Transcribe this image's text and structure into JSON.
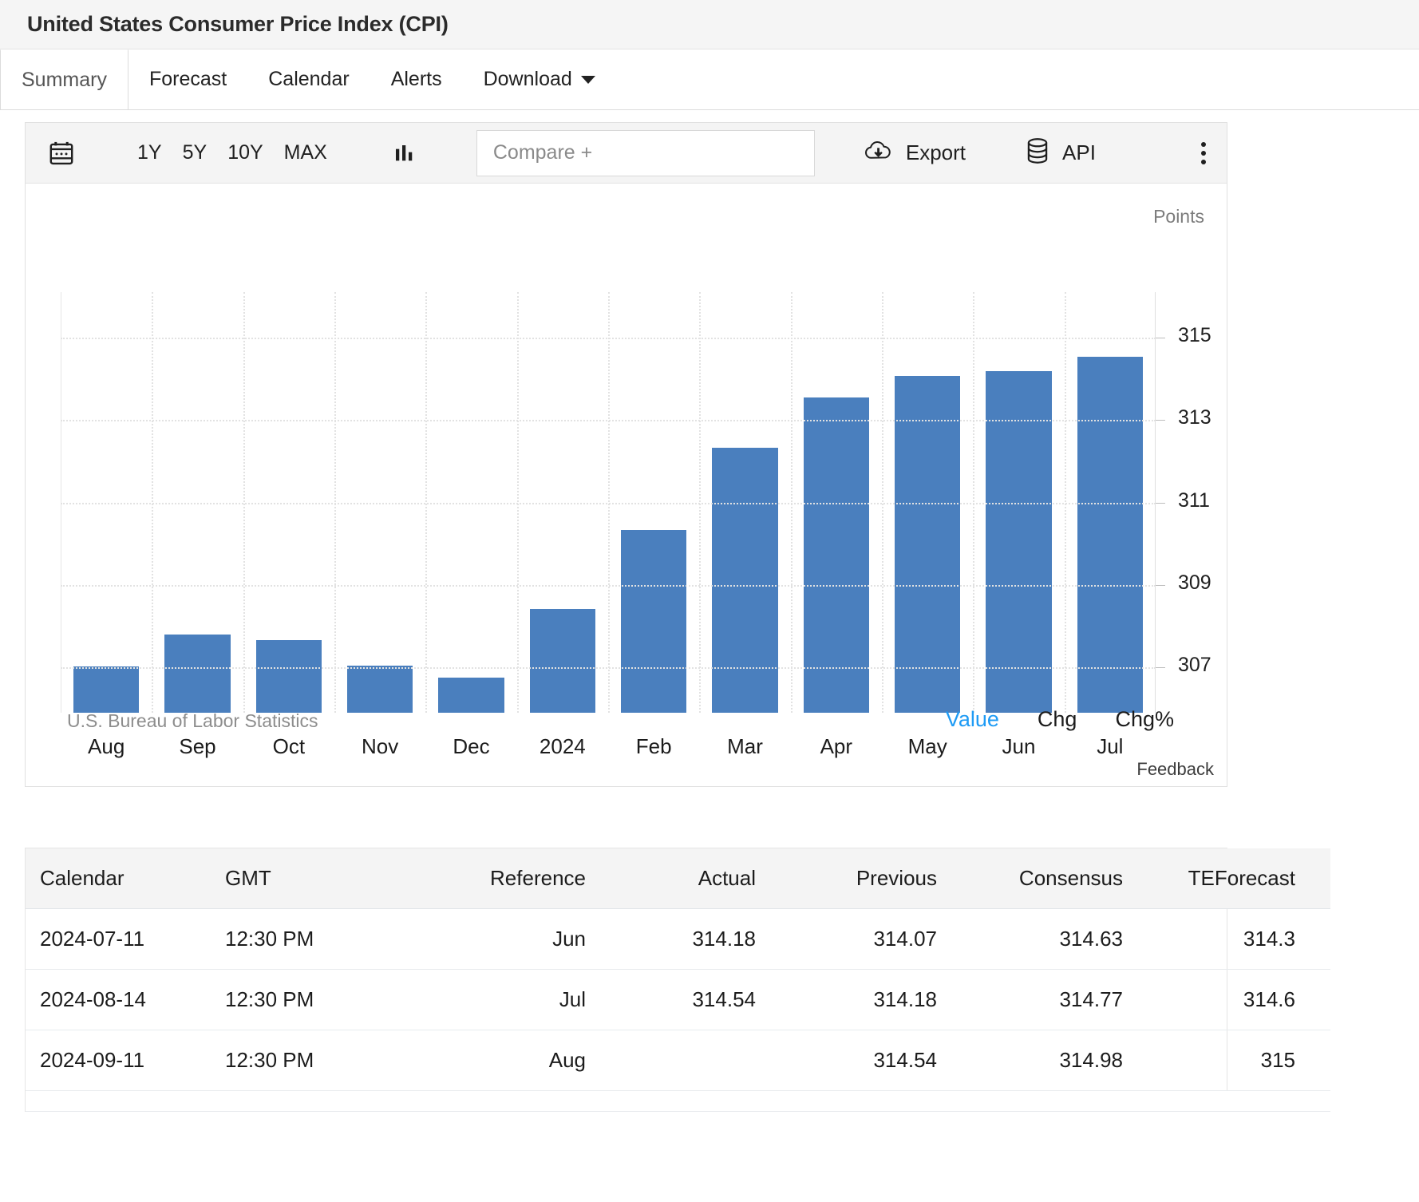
{
  "header": {
    "title": "United States Consumer Price Index (CPI)"
  },
  "tabs": [
    {
      "label": "Summary",
      "active": true
    },
    {
      "label": "Forecast",
      "active": false
    },
    {
      "label": "Calendar",
      "active": false
    },
    {
      "label": "Alerts",
      "active": false
    },
    {
      "label": "Download",
      "active": false,
      "has_caret": true
    }
  ],
  "toolbar": {
    "calendar_icon": "calendar-icon",
    "ranges": [
      "1Y",
      "5Y",
      "10Y",
      "MAX"
    ],
    "chart_type_icon": "bar-chart-icon",
    "compare_placeholder": "Compare +",
    "compare_value": "",
    "export_label": "Export",
    "export_icon": "cloud-download-icon",
    "api_label": "API",
    "api_icon": "database-icon",
    "menu_icon": "kebab-menu-icon"
  },
  "chart": {
    "units_label": "Points",
    "source": "U.S. Bureau of Labor Statistics",
    "value_modes": [
      {
        "label": "Value",
        "active": true
      },
      {
        "label": "Chg",
        "active": false
      },
      {
        "label": "Chg%",
        "active": false
      }
    ],
    "feedback_label": "Feedback",
    "bar_color": "#4a7fbe",
    "accent_color": "#1e9bf5"
  },
  "chart_data": {
    "type": "bar",
    "title": "United States Consumer Price Index (CPI)",
    "xlabel": "",
    "ylabel": "Points",
    "categories": [
      "Aug",
      "Sep",
      "Oct",
      "Nov",
      "Dec",
      "2024",
      "Feb",
      "Mar",
      "Apr",
      "May",
      "Jun",
      "Jul"
    ],
    "values": [
      307.03,
      307.79,
      307.67,
      307.05,
      306.75,
      308.42,
      310.33,
      312.33,
      313.55,
      314.07,
      314.18,
      314.54
    ],
    "ytick_labels": [
      "307",
      "309",
      "311",
      "313",
      "315"
    ],
    "ytick_values": [
      307,
      309,
      311,
      313,
      315
    ],
    "ylim": [
      305.9,
      316.1
    ],
    "grid": true,
    "legend": "none",
    "source": "U.S. Bureau of Labor Statistics"
  },
  "table": {
    "columns": [
      "Calendar",
      "GMT",
      "Reference",
      "Actual",
      "Previous",
      "Consensus",
      "TEForecast"
    ],
    "rows": [
      {
        "calendar": "2024-07-11",
        "gmt": "12:30 PM",
        "reference": "Jun",
        "actual": "314.18",
        "previous": "314.07",
        "consensus": "314.63",
        "teforecast": "314.3"
      },
      {
        "calendar": "2024-08-14",
        "gmt": "12:30 PM",
        "reference": "Jul",
        "actual": "314.54",
        "previous": "314.18",
        "consensus": "314.77",
        "teforecast": "314.6"
      },
      {
        "calendar": "2024-09-11",
        "gmt": "12:30 PM",
        "reference": "Aug",
        "actual": "",
        "previous": "314.54",
        "consensus": "314.98",
        "teforecast": "315"
      }
    ]
  }
}
